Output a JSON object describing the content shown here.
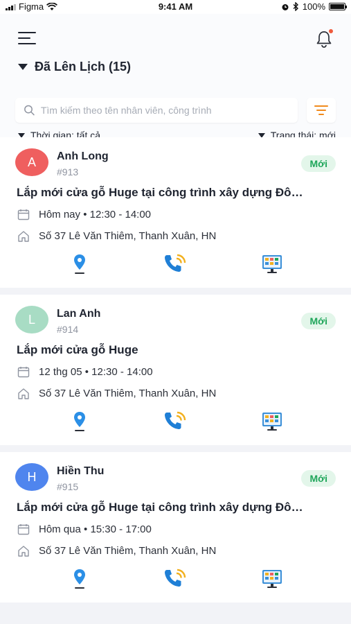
{
  "status_bar": {
    "carrier": "Figma",
    "time": "9:41 AM",
    "battery": "100%"
  },
  "header": {
    "menu_icon": "hamburger-menu-icon",
    "notification_icon": "bell-icon",
    "section_title": "Đã Lên Lịch (15)"
  },
  "search": {
    "placeholder": "Tìm kiếm theo tên nhân viên, công trình",
    "value": ""
  },
  "filters": {
    "time_label": "Thời gian: tất cả",
    "status_label": "Trạng thái: mới"
  },
  "colors": {
    "accent_orange": "#f08a1c",
    "badge_green": "#1fa65a",
    "badge_bg": "#e3f6ea",
    "map_blue": "#2b8fe6",
    "call_blue": "#1f7fd6",
    "call_orange": "#f2b01e"
  },
  "appointments": [
    {
      "initial": "A",
      "avatar_color": "#ef5f5f",
      "name": "Anh Long",
      "code": "#913",
      "status": "Mới",
      "title": "Lắp mới cửa gỗ Huge tại công trình xây dựng Đô…",
      "time": "Hôm nay • 12:30 - 14:00",
      "address": "Số 37 Lê Văn Thiêm, Thanh Xuân, HN"
    },
    {
      "initial": "L",
      "avatar_color": "#a8dcc4",
      "name": "Lan Anh",
      "code": "#914",
      "status": "Mới",
      "title": "Lắp mới cửa gỗ Huge",
      "time": "12 thg 05 • 12:30 - 14:00",
      "address": "Số 37 Lê Văn Thiêm, Thanh Xuân, HN"
    },
    {
      "initial": "H",
      "avatar_color": "#4f85ee",
      "name": "Hiền Thu",
      "code": "#915",
      "status": "Mới",
      "title": "Lắp mới cửa gỗ Huge tại công trình xây dựng Đô…",
      "time": "Hôm qua • 15:30 - 17:00",
      "address": "Số 37 Lê Văn Thiêm, Thanh Xuân, HN"
    }
  ]
}
